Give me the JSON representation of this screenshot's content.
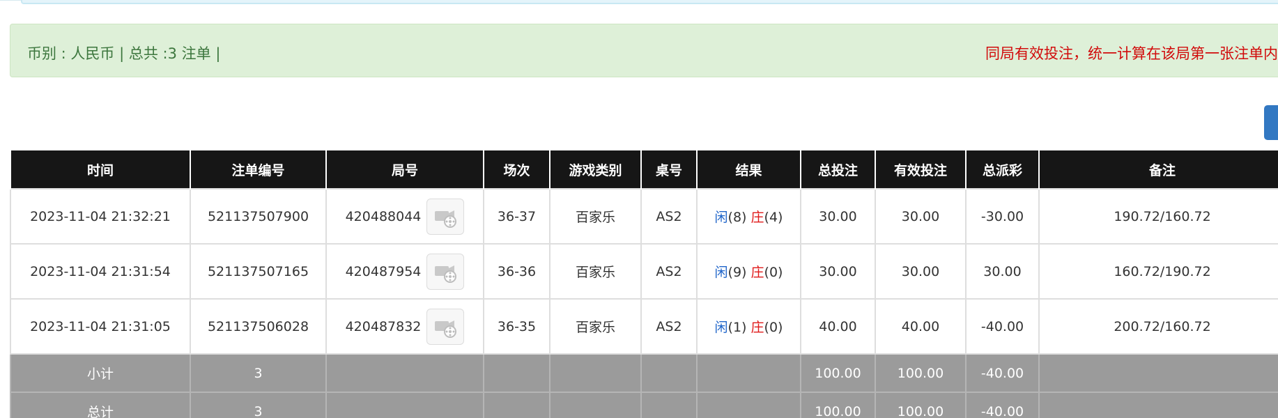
{
  "info_bar": {
    "left_text": "币别 : 人民币 | 总共 :3 注单 |",
    "right_text": "同局有效投注，统一计算在该局第一张注单内"
  },
  "table": {
    "headers": [
      "时间",
      "注单编号",
      "局号",
      "场次",
      "游戏类别",
      "桌号",
      "结果",
      "总投注",
      "有效投注",
      "总派彩",
      "备注"
    ],
    "rows": [
      {
        "time": "2023-11-04 21:32:21",
        "bet_id": "521137507900",
        "round_id": "420488044",
        "session": "36-37",
        "game_type": "百家乐",
        "table_no": "AS2",
        "result_player": "闲",
        "result_player_val": "(8)",
        "result_banker": "庄",
        "result_banker_val": "(4)",
        "total_bet": "30.00",
        "valid_bet": "30.00",
        "payout": "-30.00",
        "payout_color": "red",
        "remark": "190.72/160.72"
      },
      {
        "time": "2023-11-04 21:31:54",
        "bet_id": "521137507165",
        "round_id": "420487954",
        "session": "36-36",
        "game_type": "百家乐",
        "table_no": "AS2",
        "result_player": "闲",
        "result_player_val": "(9)",
        "result_banker": "庄",
        "result_banker_val": "(0)",
        "total_bet": "30.00",
        "valid_bet": "30.00",
        "payout": "30.00",
        "payout_color": "normal",
        "remark": "160.72/190.72"
      },
      {
        "time": "2023-11-04 21:31:05",
        "bet_id": "521137506028",
        "round_id": "420487832",
        "session": "36-35",
        "game_type": "百家乐",
        "table_no": "AS2",
        "result_player": "闲",
        "result_player_val": "(1)",
        "result_banker": "庄",
        "result_banker_val": "(0)",
        "total_bet": "40.00",
        "valid_bet": "40.00",
        "payout": "-40.00",
        "payout_color": "red",
        "remark": "200.72/160.72"
      }
    ],
    "subtotal": {
      "label": "小计",
      "count": "3",
      "total_bet": "100.00",
      "valid_bet": "100.00",
      "payout": "-40.00"
    },
    "total": {
      "label": "总计",
      "count": "3",
      "total_bet": "100.00",
      "valid_bet": "100.00",
      "payout": "-40.00"
    }
  },
  "icons": {
    "replay": "video-replay-icon"
  },
  "colors": {
    "header_bg": "#161616",
    "info_bg": "#def0d8",
    "info_text": "#3c763d",
    "notice_text": "#d10b0b",
    "blue_value": "#1e64c9",
    "red_value": "#e01919",
    "summary_bg": "#9b9b9b",
    "button_blue": "#3278c2"
  }
}
